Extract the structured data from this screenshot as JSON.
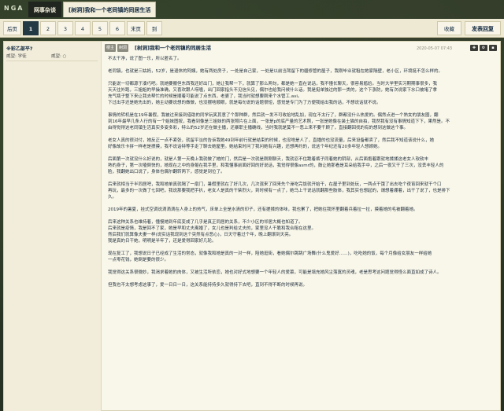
{
  "nav": {
    "logo": "NGA",
    "tabs": [
      "网事杂谈",
      "[树洞]我和一个老同镇的同居生活"
    ]
  },
  "pager": {
    "prev": "后页",
    "pages": [
      "1",
      "2",
      "3",
      "4",
      "5",
      "6"
    ],
    "last": "末页",
    "goto": "到",
    "current": "1",
    "collect": "收藏",
    "reply": "发表回复"
  },
  "user": {
    "name": "※彩乙部平?",
    "stat1": "威望: 学徒",
    "stat2": "威望: ○"
  },
  "post": {
    "tag1": "楼主",
    "tag2": "树洞",
    "title": "[树洞]我和一个老同镇的同居生活",
    "time": "2020-05-07 07:43",
    "paragraphs": [
      [
        "不太干净，说了图一乐，所以匿名了。"
      ],
      [
        "老同镇，也就是三姑妈，52岁，是退休的阿姨，她有两处房子，一处是自己家，一处是以前当驾留下的疆修管的屋子，我刚毕业就租在她家隔壁，老小区，环境挺不怎么样的。"
      ],
      [
        "只能说一切都源于凑巧吧。就她要搬但东西我还好出门，她让我帮一下，就算了那么两句，都是她一直在说话，我不懂长聊天，很容易尴尬。当时大学里实习期期事很多，我",
        "天天往外跑，三姐姐的早操准确，又喜欢跟人唠嗑，出门回家指头不见信头见，偶尔也给我问候什么话。我是挺单独过的那一类的，这个下涨防，她有次说家下水口被堵了拿",
        "充气瓶子整下来让我去帮忙的时候是顺着可能说了点东西，老婆了，我当时就想要刚来个水管工.avi。",
        "下过出手还是她先出的，她主动要说想的做做，也没摆啥顺眼，就是每句说的话题很短，感觉是专门为了方便我给出我的话，不想说话就不说。"
      ],
      [
        "事情的转机是在19年暑假，我被过来接到借助的同学玩笑其意了个那种群，然后就一发不可收拾地乱加，现在不太行了，群都没什么热爱的。偶然点进一个熟女的朋友圈，翻",
        "到16年最早几条人行的有一个姐妹图按，我看到像是三姐妹的两张照片在上面，一张是p的底产量的艺术照，一张是她像在装土猫的自拍，我然我有没有事情知道下下，果然是。不",
        "由得觉得这老同镇生活真实多姿多彩，特么的52岁还在做主播，还暴职主播确线，当时我就是莫不一恶上来不要千顾了，直接翻回找的有的想到这做这个事。"
      ],
      [
        "老女人真的很对付，她反正一点不紧张，就留平淡的告诉我她49到年前行就是结束的时候，也没啥是人了，直播的也没流量，后来设备都卖了，然后我不知道该说什么，她",
        "好像故乐卡拼一样老是撩摸，我不说话特等手走了聊去她屋里。她结束时问了我问她有兴趣，还想再约的，说这个年纪还有20多年轻人想嫁她。"
      ],
      [
        "后面第一次就没什么好说的，就是人第一天晚上我就做了她的门，然后是一次就是刚刚聊天，我就忍不住跪着裤子同着她的阴部，从后面抱着跟就地揉揉这老女人软软丰",
        "熟的身子，第一次嗑倒快的，她现在之中的身躯在我手里，和我懂事前面好回的好说话，我觉得很像asmr的，鼓让她那看是耳朵给我手中，之后一夜又干了三次，没丢丰轻人的",
        "脸，我翻她出口说了，身体也偶尔翻转两下，感觉是到位了。"
      ],
      [
        "后来就相当于半同居吧，我和她单真就隔了一扇门，暑假里就在了好几次，几次混来了回来先个澡吃完饭就开始干，在屋子里到处玩，一两点干饿了出去吃个夜宵回来就干个口",
        "再玩，最多的一次做了七回吧，我说那要我把手扒，老女人是真的干柴烈火，到时候有一点了，她乌上干说话就翻那些肢体，我其实也想起的，谓想着绷着，出干了说了，也是排下",
        "久。"
      ],
      [
        "2019年的暑夏，挂式空调说滴滴滴在人身上的热气，床单上全是水清的印子，还有搓揉的体味，我也累了，把她往我怀里翻着兵着拉一拉，摸着她的毛被翻着她。"
      ],
      [
        "后来这种关系也维持着，懂慢她到年底变成了几乎是真正同居的关系，不少小区的邻居大概也知道了。",
        "后来就是疫情，我是回不了家，她是早和丈夫离婚了，女儿也是判给丈夫的，家里没人干脆和我合租在这里。",
        "然后我们就算像夫妻一样(说实话我现到这个突然有点恶心)，日天守着过个年，晚上翻滚到天亮。",
        "我是真的日干她，明明是半年了，还是爱得回家好几轮。"
      ],
      [
        "现在复工了，我想说日子已经成了生活的常态，就像我和她是真的一对一样，陪她逛街，看她偶尔跳跳广场舞(什么鬼爱好……)，吃吃她的饭，每个月像给女朋友一样给她",
        "一点零花钱，她倒是要的很少。"
      ],
      [
        "我觉得这关系很微妙，我渴求着她的肉体，又被生活所依恋，她也对好式地想要一个年轻人的爱慕，可能是填充她风尘落寞的灵魂，老是思考这问题觉得怪么面直如成了诗人。"
      ],
      [
        "但我也不太想考虑这事了，爱一日日一日，这关系能持持多久就得持下去吧，直到不得不断的时候再说。"
      ]
    ]
  },
  "colors": {
    "background": "#2b3526",
    "panel": "#f9f7ea",
    "accent": "#233a45",
    "text": "#1d2c3a"
  }
}
